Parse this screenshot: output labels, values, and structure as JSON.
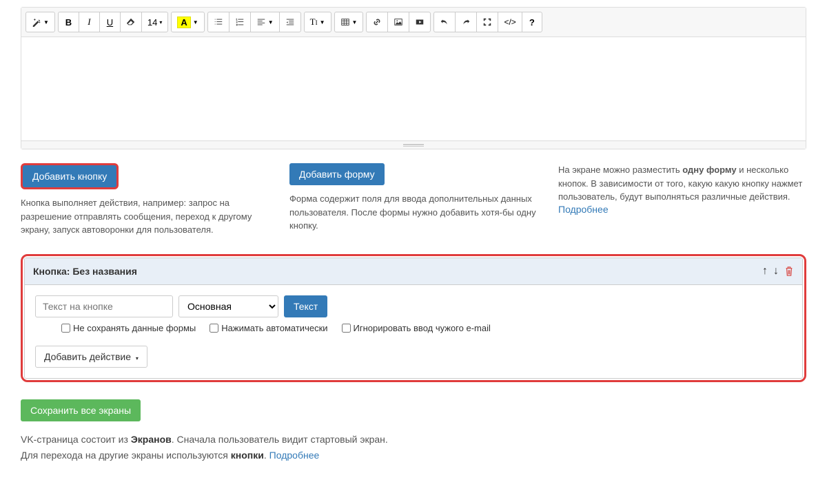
{
  "toolbar": {
    "fontsize": "14"
  },
  "actions": {
    "add_button": {
      "label": "Добавить кнопку",
      "desc": "Кнопка выполняет действия, например: запрос на разрешение отправлять сообщения, переход к другому экрану, запуск автоворонки для пользователя."
    },
    "add_form": {
      "label": "Добавить форму",
      "desc": "Форма содержит поля для ввода дополнительных данных пользователя. После формы нужно добавить хотя-бы одну кнопку."
    },
    "hint": {
      "text_pre": "На экране можно разместить ",
      "bold": "одну форму",
      "text_post": " и несколько кнопок. В зависимости от того, какую какую кнопку нажмет пользователь, будут выполняться различные действия.",
      "more": "Подробнее"
    }
  },
  "button_card": {
    "title_prefix": "Кнопка: ",
    "title_name": "Без названия",
    "placeholder": "Текст на кнопке",
    "style_options": [
      "Основная"
    ],
    "style_selected": "Основная",
    "text_btn": "Текст",
    "checkboxes": {
      "no_save": "Не сохранять данные формы",
      "auto_press": "Нажимать автоматически",
      "ignore_email": "Игнорировать ввод чужого e-mail"
    },
    "add_action": "Добавить действие"
  },
  "save_all": "Сохранить все экраны",
  "footer": {
    "line1_pre": "VK-страница состоит из ",
    "line1_bold": "Экранов",
    "line1_post": ". Сначала пользователь видит стартовый экран.",
    "line2_pre": "Для перехода на другие экраны используются ",
    "line2_bold": "кнопки",
    "line2_post": ". ",
    "more": "Подробнее"
  }
}
